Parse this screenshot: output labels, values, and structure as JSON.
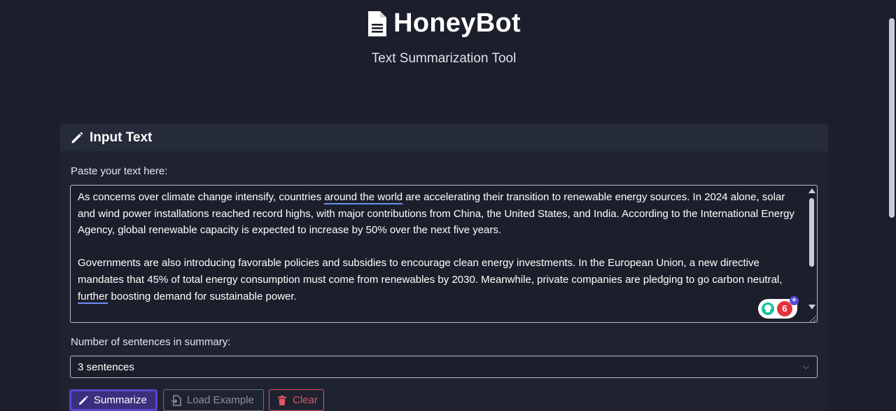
{
  "header": {
    "title": "HoneyBot",
    "subtitle": "Text Summarization Tool",
    "icon": "document-icon"
  },
  "input_card": {
    "title": "Input Text",
    "icon": "pencil-icon",
    "paste_label": "Paste your text here:",
    "text": {
      "p1_a": "As concerns over climate change intensify, countries ",
      "p1_underlined": "around the world",
      "p1_b": " are accelerating their transition to renewable energy sources. In 2024 alone, solar and wind power installations reached record highs, with major contributions from China, the United States, and India. According to the International Energy Agency, global renewable capacity is expected to increase by 50% over the next five years.",
      "p2_a": "Governments are also introducing favorable policies and subsidies to encourage clean energy investments. In the European Union, a new directive mandates that 45% of total energy consumption must come from renewables by 2030. Meanwhile, private companies are pledging to go carbon neutral, ",
      "p2_underlined": "further",
      "p2_b": " boosting demand for sustainable power."
    },
    "grammarly_count": "6",
    "grammarly_plus": "+",
    "sentences_label": "Number of sentences in summary:",
    "sentences_value": "3 sentences"
  },
  "actions": {
    "summarize": "Summarize",
    "load_example": "Load Example",
    "clear": "Clear"
  },
  "colors": {
    "background": "#1c1f2b",
    "card_header": "#262b3a",
    "primary": "#5a46c9",
    "danger": "#e25561",
    "underline": "#6b8ff2"
  }
}
